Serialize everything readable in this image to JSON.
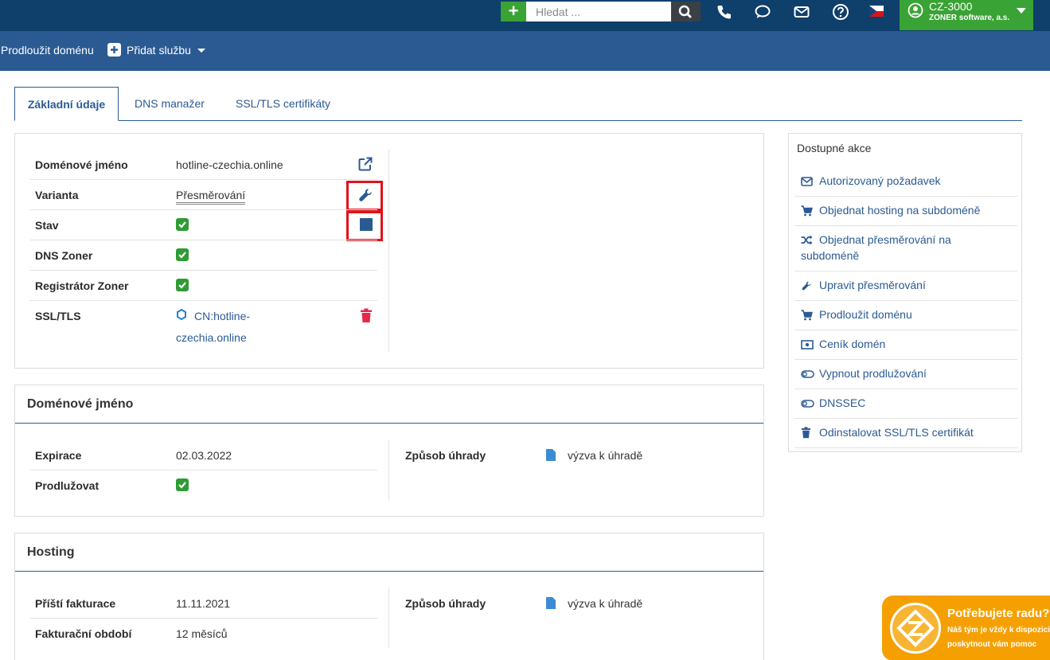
{
  "topbar": {
    "add_symbol": "+",
    "search_placeholder": "Hledat ...",
    "account_code": "CZ-3000",
    "account_company": "ZONER software, a.s."
  },
  "subbar": {
    "renew_label": "Prodloužit doménu",
    "add_service_label": "Přidat službu"
  },
  "tabs": [
    {
      "label": "Základní údaje",
      "active": true
    },
    {
      "label": "DNS manažer",
      "active": false
    },
    {
      "label": "SSL/TLS certifikáty",
      "active": false
    }
  ],
  "overview": {
    "rows": [
      {
        "label": "Doménové jméno",
        "value": "hotline-czechia.online"
      },
      {
        "label": "Varianta",
        "value": "Přesměrování"
      },
      {
        "label": "Stav",
        "value": "checked"
      },
      {
        "label": "DNS Zoner",
        "value": "checked"
      },
      {
        "label": "Registrátor Zoner",
        "value": "checked"
      },
      {
        "label": "SSL/TLS",
        "value_line1": "CN:hotline-",
        "value_line2": "czechia.online"
      }
    ]
  },
  "domain_card": {
    "title": "Doménové jméno",
    "expiry_label": "Expirace",
    "expiry_value": "02.03.2022",
    "renew_label": "Prodlužovat",
    "payment_label": "Způsob úhrady",
    "payment_value": "výzva k úhradě"
  },
  "hosting_card": {
    "title": "Hosting",
    "next_invoice_label": "Příští fakturace",
    "next_invoice_value": "11.11.2021",
    "period_label": "Fakturační období",
    "period_value": "12 měsíců",
    "payment_label": "Způsob úhrady",
    "payment_value": "výzva k úhradě"
  },
  "actions": {
    "title": "Dostupné akce",
    "items": [
      {
        "label": "Autorizovaný požadavek",
        "icon": "envelope-icon"
      },
      {
        "label": "Objednat hosting na subdoméně",
        "icon": "cart-icon"
      },
      {
        "label_line1": "Objednat přesměrování na",
        "label_line2": "subdoméně",
        "icon": "shuffle-icon"
      },
      {
        "label": "Upravit přesměrování",
        "icon": "wrench-icon"
      },
      {
        "label": "Prodloužit doménu",
        "icon": "cart-icon"
      },
      {
        "label": "Ceník domén",
        "icon": "money-icon"
      },
      {
        "label": "Vypnout prodlužování",
        "icon": "toggle-icon"
      },
      {
        "label": "DNSSEC",
        "icon": "toggle-icon"
      },
      {
        "label": "Odinstalovat SSL/TLS certifikát",
        "icon": "trash-icon"
      }
    ]
  },
  "help_widget": {
    "title": "Potřebujete radu?",
    "line1": "Náš tým je vždy k dispozici,",
    "line2": "poskytnout vám pomoc"
  },
  "colors": {
    "topbar": "#0f3f6b",
    "subbar": "#2b5a93",
    "green": "#3aa335",
    "highlight": "#e0131a",
    "help": "#f5a000"
  }
}
